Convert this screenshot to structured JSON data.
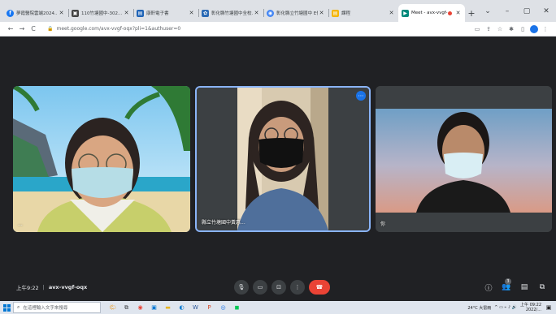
{
  "browser": {
    "tabs": [
      {
        "title": "夢霞醫院雲端2024...",
        "fav_color": "#1877f2",
        "fav_glyph": "f",
        "active": false
      },
      {
        "title": "110竹塘國中-302...",
        "fav_color": "#444",
        "fav_glyph": "▣",
        "active": false
      },
      {
        "title": "康軒電子書",
        "fav_color": "#1e63b6",
        "fav_glyph": "▤",
        "active": false
      },
      {
        "title": "彰化縣竹塘國中全校...",
        "fav_color": "#2b6ab5",
        "fav_glyph": "✿",
        "active": false
      },
      {
        "title": "彰化縣立竹塘國中 E化...",
        "fav_color": "#4285f4",
        "fav_glyph": "◉",
        "active": false
      },
      {
        "title": "課程",
        "fav_color": "#f4b400",
        "fav_glyph": "▤",
        "active": false
      },
      {
        "title": "Meet - avx-vvgf-...",
        "fav_color": "#00897b",
        "fav_glyph": "▶",
        "active": true
      }
    ],
    "new_tab": "+",
    "window_controls": {
      "chevron": "⌄",
      "minimize": "–",
      "maximize": "▢",
      "close": "✕"
    },
    "nav": {
      "back": "←",
      "forward": "→",
      "reload": "C"
    },
    "url": "meet.google.com/avx-vvgf-oqx?pli=1&authuser=0",
    "toolbar_icons": [
      "cast-icon",
      "share-icon",
      "star-icon",
      "extensions-icon",
      "sidepanel-icon",
      "profile-icon",
      "menu-icon"
    ]
  },
  "meet": {
    "tiles": [
      {
        "name": "",
        "label": "...",
        "bg": "beach"
      },
      {
        "name": "縣立竹塘國中黃惠..."
      },
      {
        "name": "你"
      }
    ],
    "time": "上午9:22",
    "separator": "|",
    "meeting_code": "avx-vvgf-oqx",
    "participant_count": "3",
    "colors": {
      "accent": "#8ab4f8",
      "hangup": "#ea4335",
      "bg": "#202124"
    }
  },
  "taskbar": {
    "search_placeholder": "在這裡輸入文字來搜尋",
    "weather": "24°C 大雷雨",
    "clock_time": "上午 09:22",
    "clock_date": "2022/..."
  }
}
